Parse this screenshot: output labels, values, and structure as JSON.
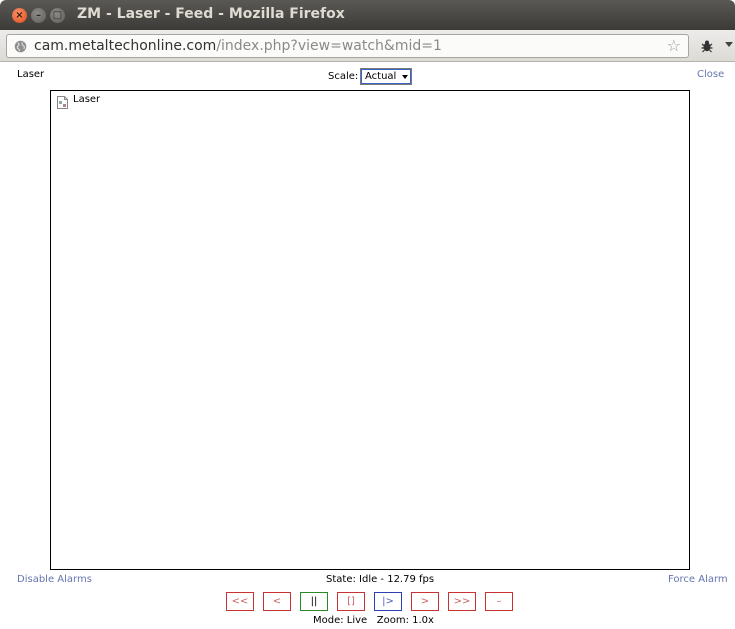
{
  "window": {
    "title": "ZM - Laser - Feed - Mozilla Firefox"
  },
  "browser": {
    "url_host": "cam.metaltechonline.com",
    "url_path": "/index.php?view=watch&mid=1",
    "bookmark_icon": "star-icon",
    "site_icon": "globe-icon"
  },
  "page": {
    "monitor_name": "Laser",
    "scale_label": "Scale:",
    "scale_value": "Actual",
    "close_label": "Close",
    "feed_alt_text": "Laser",
    "disable_alarms_label": "Disable Alarms",
    "state_text": "State: Idle - 12.79 fps",
    "force_alarm_label": "Force Alarm",
    "mode_text": "Mode: Live",
    "zoom_text": "Zoom: 1.0x",
    "controls": [
      {
        "label": "<<",
        "name": "fast-rewind-button"
      },
      {
        "label": "<",
        "name": "slow-rewind-button"
      },
      {
        "label": "||",
        "name": "pause-button"
      },
      {
        "label": "[]",
        "name": "stop-button"
      },
      {
        "label": "|>",
        "name": "play-button"
      },
      {
        "label": ">",
        "name": "slow-forward-button"
      },
      {
        "label": ">>",
        "name": "fast-forward-button"
      },
      {
        "label": "–",
        "name": "zoom-out-button"
      }
    ]
  },
  "colors": {
    "link": "#6676b0",
    "control_red": "#c83232",
    "control_green": "#2a8a2a",
    "control_blue": "#2e3fb0"
  }
}
